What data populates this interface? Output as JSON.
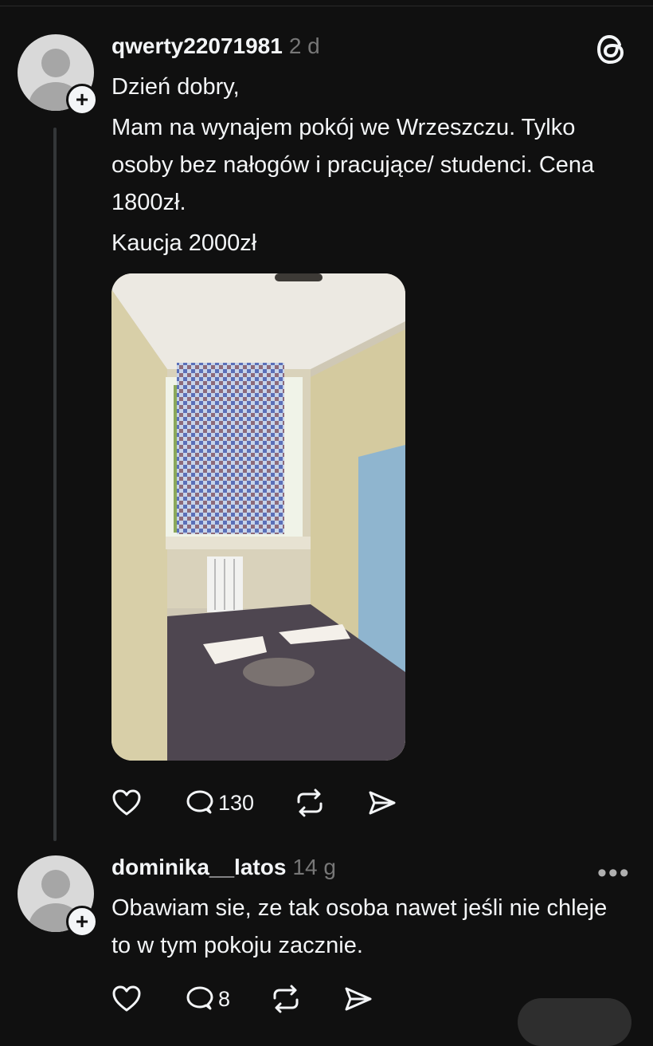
{
  "post": {
    "username": "qwerty22071981",
    "time": "2 d",
    "paragraphs": [
      "Dzień dobry,",
      "Mam na wynajem pokój we Wrzeszczu. Tylko osoby bez nałogów i pracujące/ studenci. Cena 1800zł.",
      "Kaucja 2000zł"
    ],
    "actions": {
      "like_icon": "heart-icon",
      "comment_icon": "comment-icon",
      "comment_count": "130",
      "repost_icon": "repost-icon",
      "share_icon": "share-icon"
    }
  },
  "reply": {
    "username": "dominika__latos",
    "time": "14 g",
    "text": "Obawiam sie, ze tak osoba nawet jeśli nie chleje to w tym pokoju zacznie.",
    "actions": {
      "comment_count": "8"
    }
  },
  "icons": {
    "threads_logo": "threads-logo-icon",
    "more": "more-icon"
  }
}
